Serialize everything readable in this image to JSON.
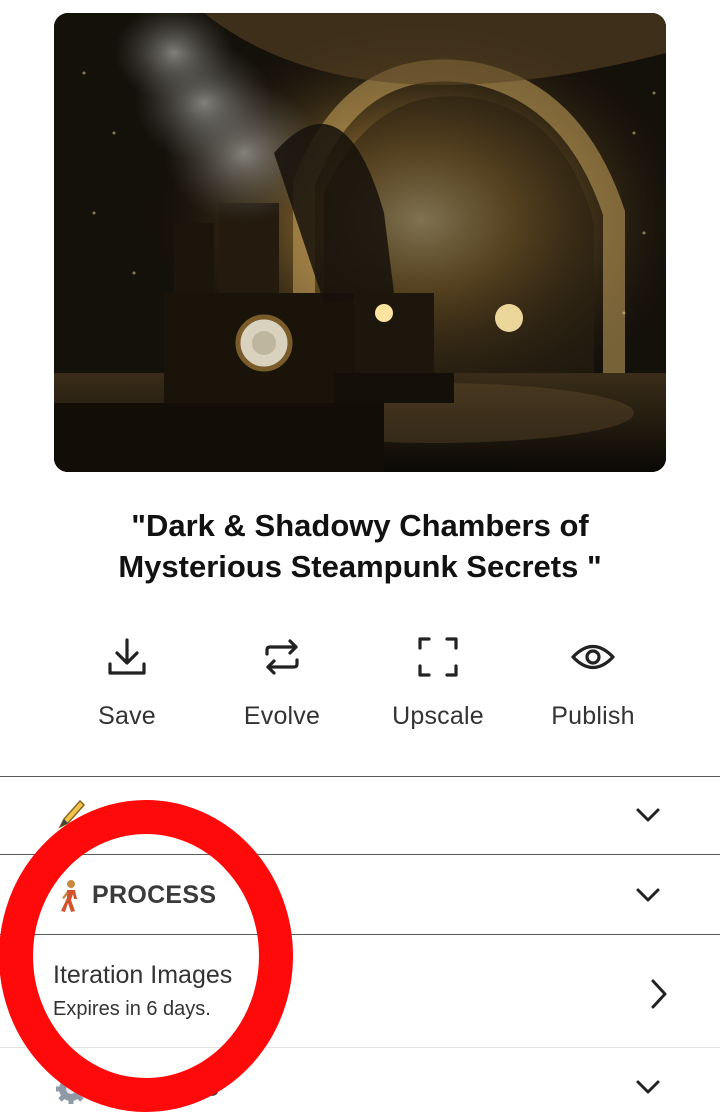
{
  "artwork": {
    "image_name": "steampunk-chamber-artwork"
  },
  "title": "\"Dark & Shadowy Chambers of Mysterious Steampunk Secrets \"",
  "actions": [
    {
      "label": "Save",
      "icon": "download-icon"
    },
    {
      "label": "Evolve",
      "icon": "swap-arrows-icon"
    },
    {
      "label": "Upscale",
      "icon": "expand-corners-icon"
    },
    {
      "label": "Publish",
      "icon": "eye-icon"
    }
  ],
  "sections": {
    "first": {
      "icon": "pencil-icon",
      "expanded": false
    },
    "process": {
      "label": "PROCESS",
      "icon": "walking-person-icon",
      "expanded": true
    },
    "iteration": {
      "title": "Iteration Images",
      "subtitle": "Expires in 6 days."
    },
    "settings": {
      "label": "SETTINGS",
      "icon": "gear-icon",
      "expanded": false
    }
  },
  "annotation": {
    "shape": "circle",
    "color": "#ff0000"
  }
}
